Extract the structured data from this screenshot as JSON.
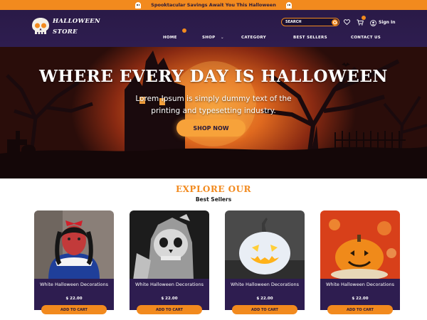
{
  "announcement": {
    "text": "Spooktacular Savings Await You This Halloween",
    "left_icon": "ghost-icon",
    "right_icon": "ghost-icon"
  },
  "header": {
    "logo": {
      "line1": "HALLOWEEN",
      "line2": "STORE",
      "icon": "skull-icon"
    },
    "search": {
      "placeholder": "SEARCH"
    },
    "icons": [
      "heart-icon",
      "cart-icon",
      "user-icon"
    ],
    "sign_in": "Sign In",
    "nav": [
      {
        "label": "HOME"
      },
      {
        "label": "SHOP"
      },
      {
        "label": "CATEGORY"
      },
      {
        "label": "BEST SELLERS"
      },
      {
        "label": "CONTACT US"
      }
    ]
  },
  "hero": {
    "title": "WHERE EVERY DAY IS HALLOWEEN",
    "subtitle": "Lorem Ipsum is simply dummy text of the printing and typesetting industry.",
    "cta": "SHOP NOW"
  },
  "section": {
    "heading": "EXPLORE OUR",
    "subheading": "Best Sellers"
  },
  "products": [
    {
      "name": "White Halloween Decorations",
      "price": "$ 22.00",
      "button": "ADD TO CART"
    },
    {
      "name": "White Halloween Decorations",
      "price": "$ 22.00",
      "button": "ADD TO CART"
    },
    {
      "name": "White Halloween Decorations",
      "price": "$ 22.00",
      "button": "ADD TO CART"
    },
    {
      "name": "White Halloween Decorations",
      "price": "$ 22.00",
      "button": "ADD TO CART"
    }
  ],
  "colors": {
    "accent": "#f28a1e",
    "header_bg": "#2e1d50",
    "card_info_bg": "#2e1d50"
  }
}
